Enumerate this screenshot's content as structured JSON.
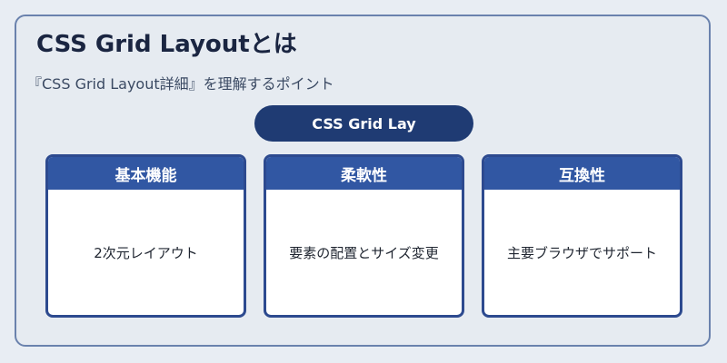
{
  "title": "CSS Grid Layoutとは",
  "subtitle": "『CSS Grid Layout詳細』を理解するポイント",
  "pill_label": "CSS Grid Lay",
  "cards": [
    {
      "heading": "基本機能",
      "body": "2次元レイアウト"
    },
    {
      "heading": "柔軟性",
      "body": "要素の配置とサイズ変更"
    },
    {
      "heading": "互換性",
      "body": "主要ブラウザでサポート"
    }
  ],
  "colors": {
    "frame_border": "#6a82ad",
    "pill_bg": "#1f3b73",
    "card_head_bg": "#3157a3",
    "card_border": "#2d4a8f"
  }
}
